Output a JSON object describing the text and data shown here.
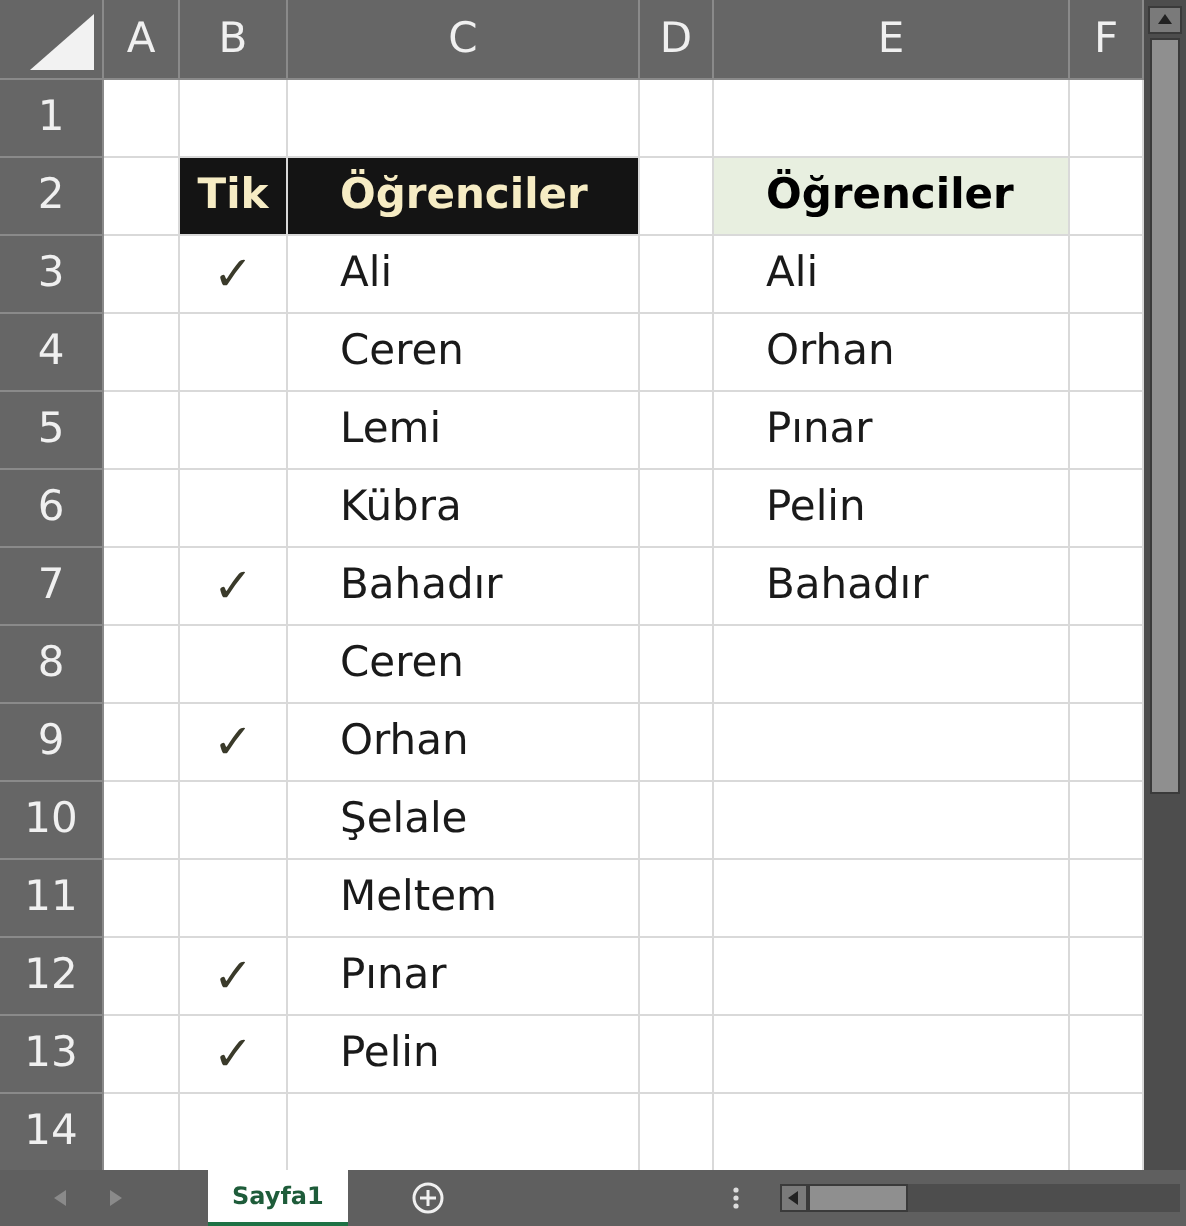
{
  "columns": [
    "A",
    "B",
    "C",
    "D",
    "E",
    "F"
  ],
  "rows": [
    {
      "number": "1",
      "kind": "data"
    },
    {
      "number": "2",
      "kind": "header",
      "tick": "Tik",
      "name": "Öğrenciler",
      "result": "Öğrenciler"
    },
    {
      "number": "3",
      "kind": "data",
      "tick": "✓",
      "name": "Ali",
      "result": "Ali"
    },
    {
      "number": "4",
      "kind": "data",
      "name": "Ceren",
      "result": "Orhan"
    },
    {
      "number": "5",
      "kind": "data",
      "name": "Lemi",
      "result": "Pınar"
    },
    {
      "number": "6",
      "kind": "data",
      "name": "Kübra",
      "result": "Pelin"
    },
    {
      "number": "7",
      "kind": "data",
      "tick": "✓",
      "name": "Bahadır",
      "result": "Bahadır"
    },
    {
      "number": "8",
      "kind": "data",
      "name": "Ceren"
    },
    {
      "number": "9",
      "kind": "data",
      "tick": "✓",
      "name": "Orhan"
    },
    {
      "number": "10",
      "kind": "data",
      "name": "Şelale"
    },
    {
      "number": "11",
      "kind": "data",
      "name": "Meltem"
    },
    {
      "number": "12",
      "kind": "data",
      "tick": "✓",
      "name": "Pınar"
    },
    {
      "number": "13",
      "kind": "data",
      "tick": "✓",
      "name": "Pelin"
    },
    {
      "number": "14",
      "kind": "data"
    }
  ],
  "sheet_tabs": [
    {
      "label": "Sayfa1",
      "selected": true
    }
  ]
}
